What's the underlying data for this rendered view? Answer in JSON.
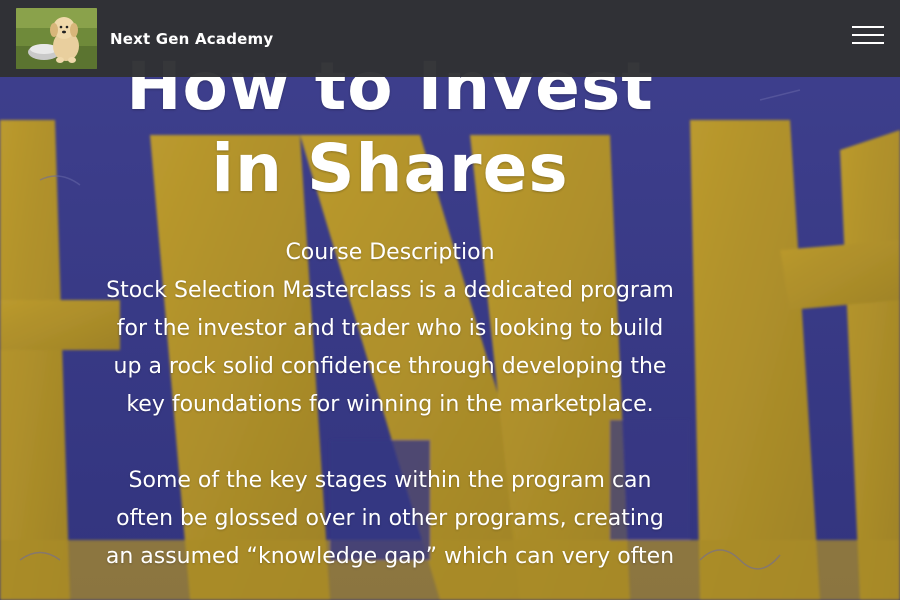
{
  "header": {
    "brand_name": "Next Gen Academy",
    "logo_icon": "puppy-photo-logo",
    "menu_icon": "hamburger-menu-icon"
  },
  "hero": {
    "title": "How to Invest in Shares",
    "paragraphs": [
      "Course Description",
      "Stock Selection Masterclass is a dedicated program for the investor and trader who is looking to build up a rock solid confidence through developing the key foundations for winning in the marketplace.",
      "Some of the key stages within the program can often be glossed over in other programs, creating an assumed “knowledge gap” which can very often"
    ]
  },
  "colors": {
    "navbar_bg": "#303134",
    "hero_bg_blue": "#3e3f8e",
    "hero_bg_gold": "#c9a52c",
    "text": "#ffffff"
  }
}
